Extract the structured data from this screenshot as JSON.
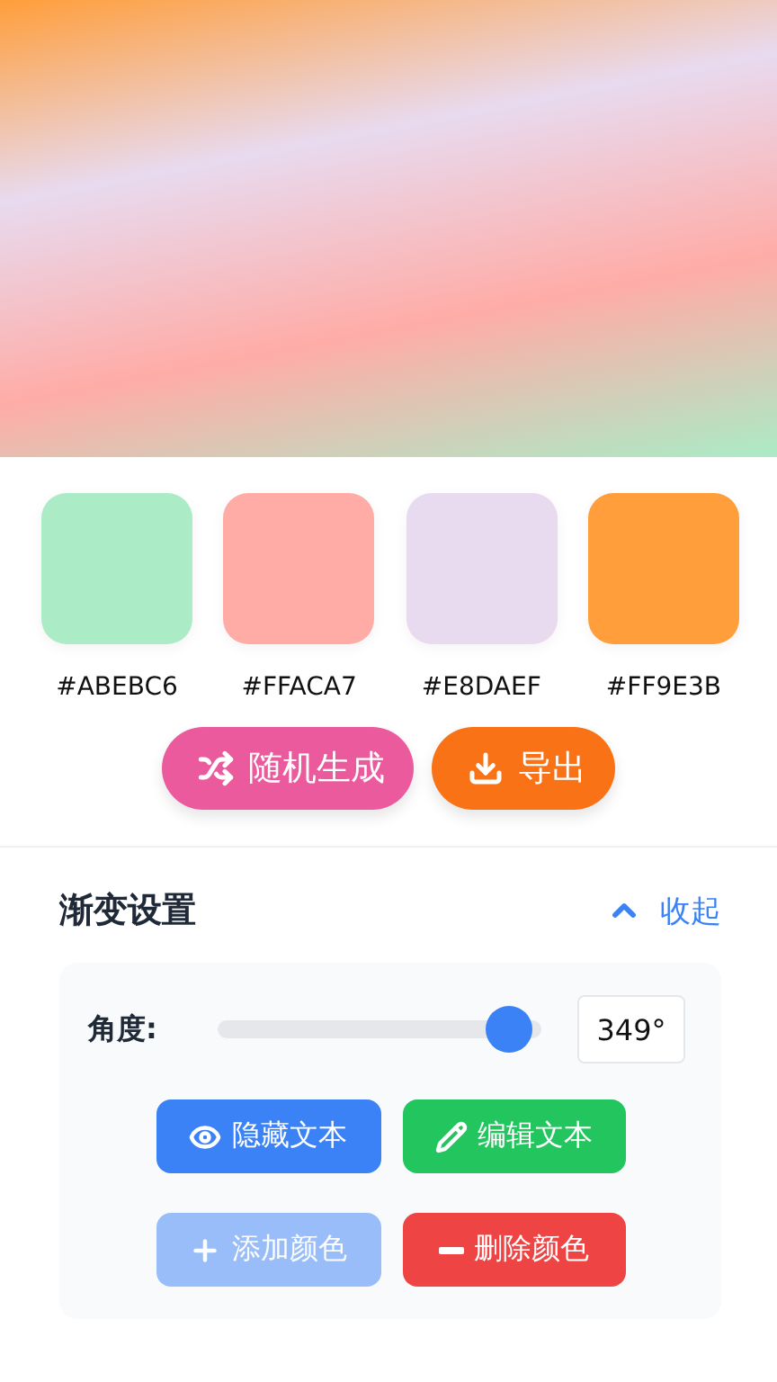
{
  "swatches": [
    {
      "hex": "#ABEBC6",
      "color": "#abebc6"
    },
    {
      "hex": "#FFACA7",
      "color": "#ffaca7"
    },
    {
      "hex": "#E8DAEF",
      "color": "#e8daef"
    },
    {
      "hex": "#FF9E3B",
      "color": "#ff9e3b"
    }
  ],
  "actions": [
    {
      "kind": "shuffle",
      "label": "随机生成"
    },
    {
      "kind": "export",
      "label": "导出"
    }
  ],
  "settings": {
    "title": "渐变设置",
    "toggle": {
      "label": "收起",
      "expanded": true
    },
    "angle": {
      "label": "角度:",
      "level": 0.97,
      "value": "349°"
    },
    "buttons": [
      {
        "kind": "eye",
        "label": "隐藏文本",
        "disabled": false
      },
      {
        "kind": "edit",
        "label": "编辑文本",
        "disabled": false
      },
      {
        "kind": "add",
        "label": "添加颜色",
        "disabled": true
      },
      {
        "kind": "remove",
        "label": "删除颜色",
        "disabled": false
      }
    ]
  }
}
